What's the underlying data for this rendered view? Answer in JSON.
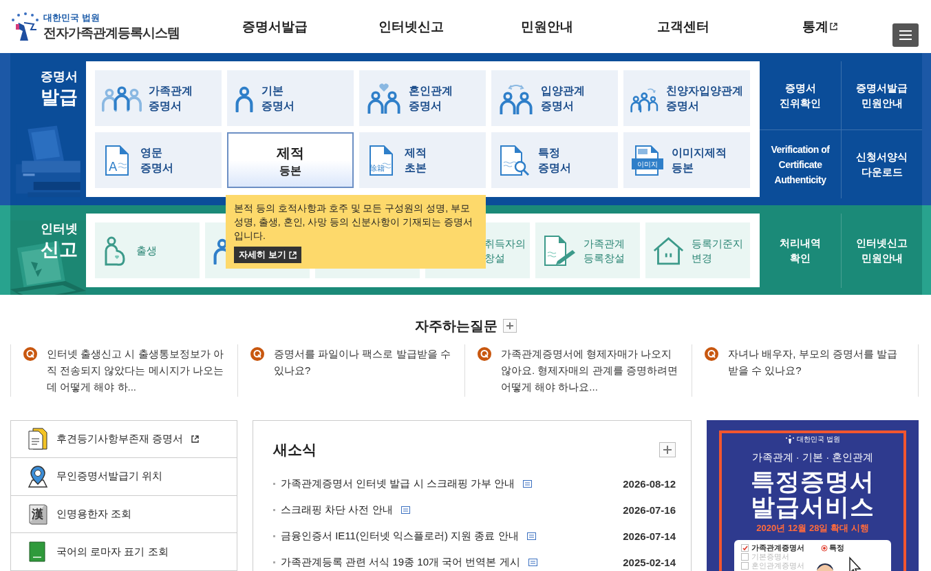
{
  "header": {
    "org": "대한민국 법원",
    "title": "전자가족관계등록시스템",
    "nav": [
      {
        "label": "증명서발급",
        "external": false
      },
      {
        "label": "인터넷신고",
        "external": false
      },
      {
        "label": "민원안내",
        "external": false
      },
      {
        "label": "고객센터",
        "external": false
      },
      {
        "label": "통계",
        "external": true
      }
    ]
  },
  "certificates": {
    "heading": [
      "증명서",
      "발급"
    ],
    "tiles": [
      {
        "lines": [
          "가족관계",
          "증명서"
        ],
        "kind": "family",
        "selected": false
      },
      {
        "lines": [
          "기본",
          "증명서"
        ],
        "kind": "person",
        "selected": false
      },
      {
        "lines": [
          "혼인관계",
          "증명서"
        ],
        "kind": "couple-heart",
        "selected": false
      },
      {
        "lines": [
          "입양관계",
          "증명서"
        ],
        "kind": "couple-arrow",
        "selected": false
      },
      {
        "lines": [
          "친양자입양관계",
          "증명서"
        ],
        "kind": "family-arrow",
        "selected": false
      },
      {
        "lines": [
          "영문",
          "증명서"
        ],
        "kind": "doc-letter",
        "icon_text": "A",
        "selected": false
      },
      {
        "lines": [
          "제적",
          "등본"
        ],
        "kind": "doc-letter",
        "selected": true
      },
      {
        "lines": [
          "제적",
          "초본"
        ],
        "kind": "doc-letter",
        "icon_text": "除籍",
        "selected": false
      },
      {
        "lines": [
          "특정",
          "증명서"
        ],
        "kind": "doc-search",
        "selected": false
      },
      {
        "lines": [
          "이미지제적",
          "등본"
        ],
        "kind": "doc-image",
        "icon_text": "이미지",
        "selected": false
      }
    ],
    "links": [
      [
        "증명서",
        "진위확인"
      ],
      [
        "증명서발급",
        "민원안내"
      ],
      [
        "Verification of",
        "Certificate",
        "Authenticity"
      ],
      [
        "신청서양식",
        "다운로드"
      ]
    ]
  },
  "tooltip": {
    "text": "본적 등의 호적사항과 호주 및 모든 구성원의 성명, 부모 성명, 출생, 혼인, 사망 등의 신분사항이 기재되는 증명서입니다.",
    "button": "자세히 보기"
  },
  "reports": {
    "heading": [
      "인터넷",
      "신고"
    ],
    "tiles": [
      {
        "lines": [
          "출생"
        ],
        "kind": "pregnant"
      },
      {
        "kind": "person"
      },
      {
        "kind": "blank"
      },
      {
        "lines": [
          "취득자의",
          "창설"
        ]
      },
      {
        "lines": [
          "가족관계",
          "등록창설"
        ],
        "kind": "doc-pen"
      },
      {
        "lines": [
          "등록기준지",
          "변경"
        ],
        "kind": "house"
      }
    ],
    "links": [
      [
        "처리내역",
        "확인"
      ],
      [
        "인터넷신고",
        "민원안내"
      ]
    ]
  },
  "faq": {
    "title": "자주하는질문",
    "items": [
      "인터넷 출생신고 시 출생통보정보가 아직 전송되지 않았다는 메시지가 나오는데 어떻게 해야 하...",
      "증명서를 파일이나 팩스로 발급받을 수 있나요?",
      "가족관계증명서에 형제자매가 나오지 않아요. 형제자매의 관계를 증명하려면 어떻게 해야 하나요...",
      "자녀나 배우자, 부모의 증명서를 발급받을 수 있나요?"
    ]
  },
  "quick_links": [
    {
      "label": "후견등기사항부존재 증명서",
      "kind": "document",
      "external": true
    },
    {
      "label": "무인증명서발급기 위치",
      "kind": "map-pin",
      "external": false
    },
    {
      "label": "인명용한자 조회",
      "kind": "hanja-book",
      "icon_text": "漢",
      "external": false
    },
    {
      "label": "국어의 로마자 표기 조회",
      "kind": "green-book",
      "external": false
    }
  ],
  "news": {
    "title": "새소식",
    "items": [
      {
        "title": "가족관계증명서 인터넷 발급 시 스크래핑 가부 안내",
        "date": "2026-08-12"
      },
      {
        "title": "스크래핑 차단 사전 안내",
        "date": "2026-07-16"
      },
      {
        "title": "금융인증서 IE11(인터넷 익스플로러) 지원 종료 안내",
        "date": "2026-07-14"
      },
      {
        "title": "가족관계등록 관련 서식 19종 10개 국어 번역본 게시",
        "date": "2025-02-14"
      }
    ]
  },
  "banner": {
    "org": "대한민국 법원",
    "subtitle": "가족관계 · 기본 · 혼인관계",
    "headline": [
      "특정증명서",
      "발급서비스"
    ],
    "notice": "2020년 12월 28일 확대 시행",
    "options": [
      {
        "label": "가족관계증명서",
        "checked": true,
        "choice": "특정"
      },
      {
        "label": "기본증명서",
        "checked": false
      },
      {
        "label": "혼인관계증명서",
        "checked": false
      }
    ]
  }
}
